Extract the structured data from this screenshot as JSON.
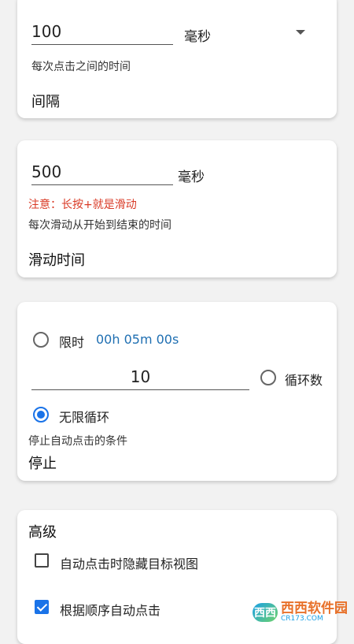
{
  "interval": {
    "value": "100",
    "unit": "毫秒",
    "help": "每次点击之间的时间",
    "title": "间隔"
  },
  "swipe": {
    "value": "500",
    "unit": "毫秒",
    "warning": "注意：长按+就是滑动",
    "help": "每次滑动从开始到结束的时间",
    "title": "滑动时间"
  },
  "stop": {
    "options": {
      "time_limit_label": "限时",
      "time_limit_value": "00h 05m 00s",
      "cycles_value": "10",
      "cycles_label": "循环数",
      "infinite_label": "无限循环"
    },
    "selected": "infinite",
    "help": "停止自动点击的条件",
    "title": "停止"
  },
  "advanced": {
    "title": "高级",
    "options": [
      {
        "label": "自动点击时隐藏目标视图",
        "checked": false
      },
      {
        "label": "根据顺序自动点击",
        "checked": true
      }
    ]
  },
  "watermark": {
    "logo": "西西",
    "main": "西西软件园",
    "sub": "CR173.COM"
  },
  "colors": {
    "accent": "#1a73e8",
    "warning": "#d93a26",
    "link": "#1f6fb2"
  }
}
